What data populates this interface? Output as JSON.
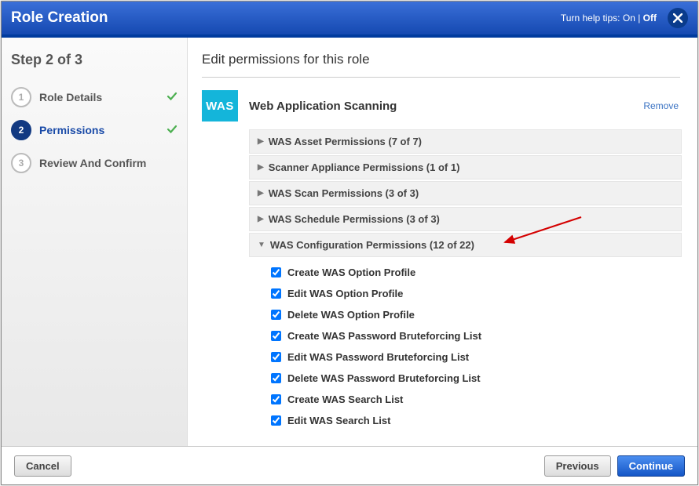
{
  "header": {
    "title": "Role Creation",
    "help_label": "Turn help tips:",
    "help_on": "On",
    "help_off": "Off"
  },
  "sidebar": {
    "step_label": "Step 2 of 3",
    "steps": [
      {
        "num": "1",
        "label": "Role Details",
        "done": true,
        "active": false
      },
      {
        "num": "2",
        "label": "Permissions",
        "done": true,
        "active": true
      },
      {
        "num": "3",
        "label": "Review And Confirm",
        "done": false,
        "active": false
      }
    ]
  },
  "main": {
    "title": "Edit permissions for this role",
    "remove_label": "Remove",
    "module": {
      "badge": "WAS",
      "name": "Web Application Scanning"
    },
    "groups": [
      {
        "label": "WAS Asset Permissions (7 of 7)",
        "expanded": false
      },
      {
        "label": "Scanner Appliance Permissions (1 of 1)",
        "expanded": false
      },
      {
        "label": "WAS Scan Permissions (3 of 3)",
        "expanded": false
      },
      {
        "label": "WAS Schedule Permissions (3 of 3)",
        "expanded": false
      },
      {
        "label": "WAS Configuration Permissions (12 of 22)",
        "expanded": true,
        "items": [
          {
            "label": "Create WAS Option Profile",
            "checked": true
          },
          {
            "label": "Edit WAS Option Profile",
            "checked": true
          },
          {
            "label": "Delete WAS Option Profile",
            "checked": true
          },
          {
            "label": "Create WAS Password Bruteforcing List",
            "checked": true
          },
          {
            "label": "Edit WAS Password Bruteforcing List",
            "checked": true
          },
          {
            "label": "Delete WAS Password Bruteforcing List",
            "checked": true
          },
          {
            "label": "Create WAS Search List",
            "checked": true
          },
          {
            "label": "Edit WAS Search List",
            "checked": true
          }
        ]
      }
    ]
  },
  "footer": {
    "cancel": "Cancel",
    "previous": "Previous",
    "continue": "Continue"
  }
}
